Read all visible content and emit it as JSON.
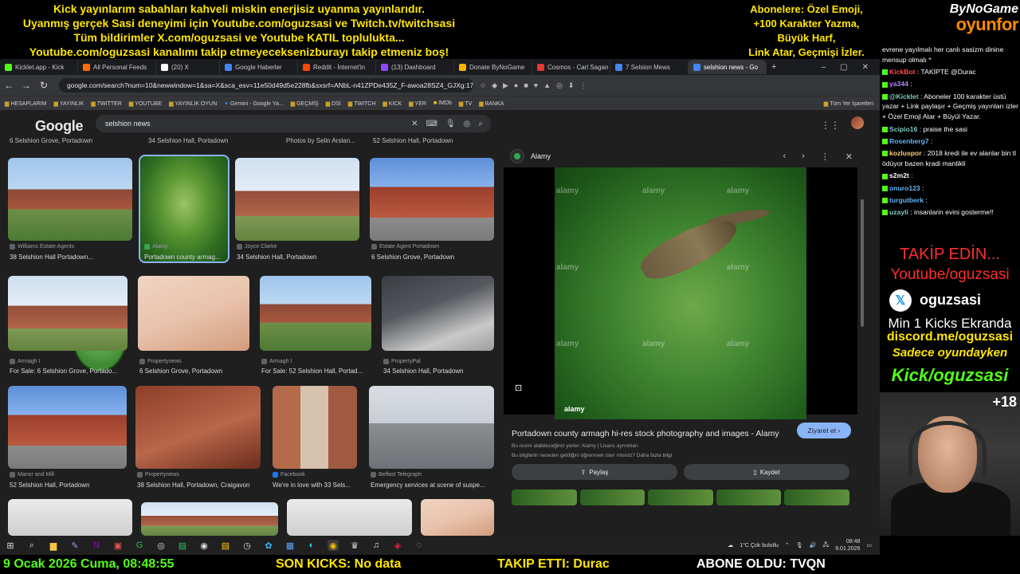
{
  "overlay": {
    "line1": "Kick yayınlarım sabahları kahveli miskin enerjisiz uyanma yayınlarıdır.",
    "line2": "Uyanmış gerçek Sasi deneyimi için Youtube.com/oguzsasi ve Twitch.tv/twitchsasi",
    "line3": "Tüm bildirimler X.com/oguzsasi ve Youtube KATIL topluluktа...",
    "line4": "Youtube.com/oguzsasi kanalımı takip etmeyeceksenizburayı takip etmeniz boş!",
    "subs1": "Abonelere: Özel Emoji,",
    "subs2": "+100 Karakter Yazma,",
    "subs3": "Büyük Harf,",
    "subs4": "Link Atar, Geçmişi İzler.",
    "logo_top": "ByNoGame",
    "logo_bottom": "oyunfor"
  },
  "browser": {
    "tabs": [
      {
        "label": "Kicklet.app - Kick",
        "color": "#53fc18"
      },
      {
        "label": "All Personal Feeds",
        "color": "#ff6d00"
      },
      {
        "label": "(20) X",
        "color": "#ffffff"
      },
      {
        "label": "Google Haberler",
        "color": "#4285f4"
      },
      {
        "label": "Reddit - İnternet'in",
        "color": "#ff4500"
      },
      {
        "label": "(13) Dashboard",
        "color": "#9146ff"
      },
      {
        "label": "Donate ByNoGame",
        "color": "#ffb300"
      },
      {
        "label": "Cosmos - Carl Sagan",
        "color": "#e53935"
      },
      {
        "label": "7 Selsion Mews",
        "color": "#4285f4"
      },
      {
        "label": "selshion news - Go",
        "color": "#4285f4"
      }
    ],
    "url": "google.com/search?num=10&newwindow=1&sa=X&sca_esv=11e50d49d5e228fb&sxsrf=ANbL-n41ZPDe435Z_F-awoa28SZ4_GJXg:17...",
    "bookmarks": [
      "HESAPLARIM",
      "YAYINLIK",
      "TWITTER",
      "YOUTUBE",
      "YAYINLIK OYUN",
      "Gemini - Google Ya...",
      "GEÇMİŞ",
      "DSİ",
      "TWITCH",
      "KICK",
      "YER",
      "IMDb",
      "TV",
      "BANKA",
      "Tüm Yer İşaretleri"
    ]
  },
  "google": {
    "logo": "Google",
    "query": "selshion news",
    "top_captions": [
      "6 Selshion Grove, Portadown",
      "34 Selshion Hall, Portadown",
      "Photos by Selin Arslan...",
      "52 Selshion Hall, Portadown"
    ],
    "results": [
      {
        "source": "Williams Estate Agents",
        "title": "38 Selshion Hall Portadown..."
      },
      {
        "source": "Alamy",
        "title": "Portadown county armag..."
      },
      {
        "source": "Joyce Clarke",
        "title": "34 Selshion Hall, Portadown"
      },
      {
        "source": "Estate Agent Portadown",
        "title": "6 Selshion Grove, Portadown"
      },
      {
        "source": "Armagh I",
        "title": "For Sale: 6 Selshion Grove, Portado..."
      },
      {
        "source": "Propertynews",
        "title": "6 Selshion Grove, Portadown"
      },
      {
        "source": "Armagh I",
        "title": "For Sale: 52 Selshion Hall, Portad..."
      },
      {
        "source": "PropertyPal",
        "title": "34 Selshion Hall, Portadown"
      },
      {
        "source": "Manor and Mill",
        "title": "52 Selshion Hall, Portadown"
      },
      {
        "source": "Propertynews",
        "title": "38 Selshion Hall, Portadown, Craigavon"
      },
      {
        "source": "Facebook",
        "title": "We're in love with 33 Sels..."
      },
      {
        "source": "Belfast Telegraph",
        "title": "Emergency services at scene of suspe..."
      }
    ],
    "preview": {
      "source": "Alamy",
      "watermark": "alamy",
      "title": "Portadown county armagh hi-res stock photography and images - Alamy",
      "visit": "Ziyaret et",
      "rights": "Bu resmi alabileceğiniz yerler: Alamy | Lisans ayrıntıları",
      "learn": "Bu bilgilerin nereden geldiğini öğrenmek ister misiniz? Daha fazla bilgi",
      "share": "Paylaş",
      "save": "Kaydet"
    }
  },
  "taskbar": {
    "weather": "1°C  Çok bulutlu",
    "time": "08:48",
    "date": "9.01.2026"
  },
  "ticker": {
    "datetime": "9 Ocak 2026 Cuma, 08:48:55",
    "kicks": "SON KICKS: No data",
    "follow": "TAKIP ETTI: Durac",
    "sub": "ABONE OLDU: TVQN"
  },
  "chat": {
    "messages": [
      {
        "user": "",
        "text": "evrene yayılmalı her canlı sasizm dinine mensup olmalı *",
        "color": "#ffffff"
      },
      {
        "user": "KickBot",
        "text": ": TAKİPTE @Durac",
        "color": "#ff4d4d"
      },
      {
        "user": "ya344",
        "text": ":",
        "color": "#b388ff"
      },
      {
        "user": "@Kicklet",
        "text": ": Aboneler 100 karakter üstü yazar + Link paylaşır + Geçmiş yayınları izler + Özel Emoji Atar + Büyül Yazar.",
        "color": "#80cbc4"
      },
      {
        "user": "Scipio16",
        "text": ": praise the sasi",
        "color": "#80cbc4"
      },
      {
        "user": "Rosenberg7",
        "text": ":",
        "color": "#64b5f6"
      },
      {
        "user": "kozluspor",
        "text": ": 2018 kredi ile ev alanlar bin tl ödüyor bazen kradi mantikli",
        "color": "#ffcc80"
      },
      {
        "user": "s2m2t",
        "text": ":",
        "color": "#ffffff"
      },
      {
        "user": "onuro123",
        "text": ":",
        "color": "#64b5f6"
      },
      {
        "user": "turgutberk",
        "text": ":",
        "color": "#64b5f6"
      },
      {
        "user": "uzayli",
        "text": ": insanlarin evini gosterme!!",
        "color": "#80cbc4"
      }
    ]
  },
  "promo": {
    "follow": "TAKİP EDİN...",
    "youtube": "Youtube/oguzsasi",
    "x_handle": "oguzsasi",
    "kicks": "Min 1 Kicks Ekranda",
    "discord": "discord.me/oguzsasi",
    "game": "Sadece oyundayken",
    "kick": "Kick/oguzsasi",
    "age": "+18"
  }
}
